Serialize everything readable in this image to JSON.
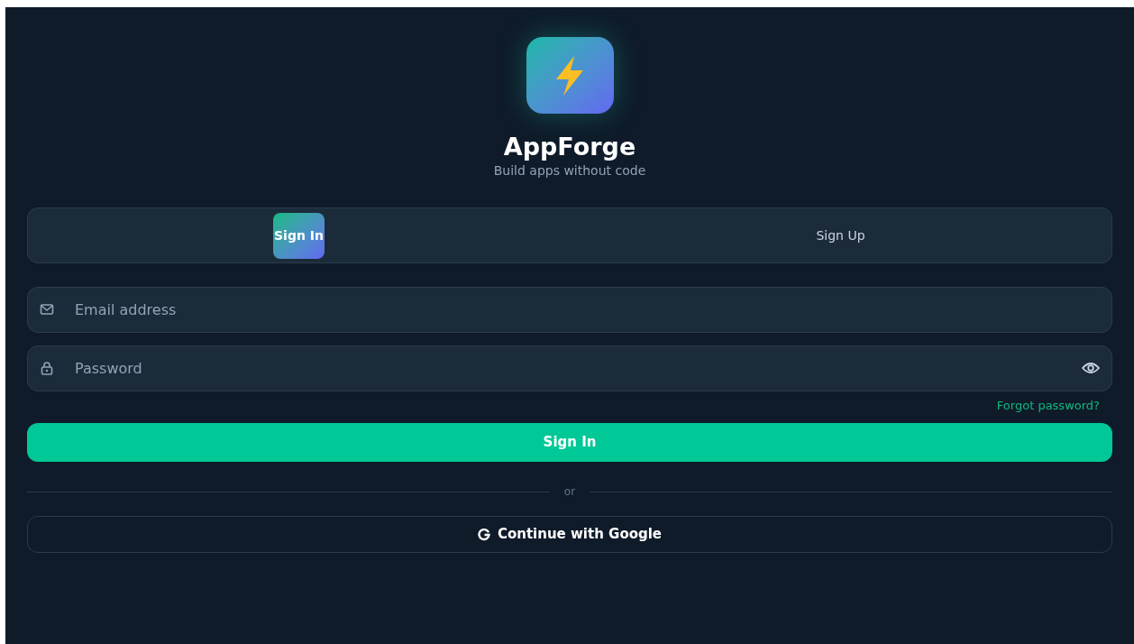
{
  "brand": {
    "name": "AppForge",
    "tagline": "Build apps without code"
  },
  "tabs": [
    {
      "label": "Sign In",
      "selected": true
    },
    {
      "label": "Sign Up",
      "selected": false
    }
  ],
  "fields": [
    {
      "kind": "email",
      "placeholder": "Email address"
    },
    {
      "kind": "password",
      "placeholder": "Password"
    }
  ],
  "forgot_link": "Forgot password?",
  "submit_button": "Sign In",
  "divider": "or",
  "google_button": "Continue with Google"
}
